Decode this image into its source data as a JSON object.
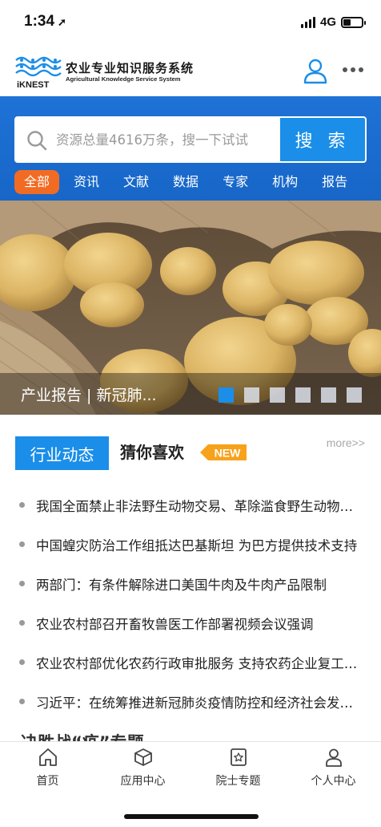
{
  "status_bar": {
    "time": "1:34",
    "network": "4G"
  },
  "app": {
    "logo_text": "iKNEST",
    "title": "农业专业知识服务系统",
    "subtitle": "Agricultural Knowledge Service System"
  },
  "search": {
    "placeholder": "资源总量4616万条，搜一下试试",
    "button_label": "搜 索"
  },
  "categories": [
    {
      "label": "全部",
      "active": true
    },
    {
      "label": "资讯",
      "active": false
    },
    {
      "label": "文献",
      "active": false
    },
    {
      "label": "数据",
      "active": false
    },
    {
      "label": "专家",
      "active": false
    },
    {
      "label": "机构",
      "active": false
    },
    {
      "label": "报告",
      "active": false
    }
  ],
  "banner": {
    "caption": "产业报告 | 新冠肺...",
    "slide_count": 6,
    "active_slide": 1
  },
  "news_tabs": {
    "industry_label": "行业动态",
    "guess_label": "猜你喜欢",
    "new_badge": "NEW",
    "more_label": "more>>"
  },
  "news_items": [
    "我国全面禁止非法野生动物交易、革除滥食野生动物陋习",
    "中国蝗灾防治工作组抵达巴基斯坦 为巴方提供技术支持",
    "两部门：有条件解除进口美国牛肉及牛肉产品限制",
    "农业农村部召开畜牧兽医工作部署视频会议强调",
    "农业农村部优化农药行政审批服务 支持农药企业复工复产",
    "习近平：在统筹推进新冠肺炎疫情防控和经济社会发展工作"
  ],
  "next_section_peek": "决胜战“疫”专题",
  "bottom_nav": [
    {
      "label": "首页",
      "icon": "home-icon"
    },
    {
      "label": "应用中心",
      "icon": "cube-icon"
    },
    {
      "label": "院士专题",
      "icon": "star-doc-icon"
    },
    {
      "label": "个人中心",
      "icon": "person-icon"
    }
  ],
  "colors": {
    "brand_blue": "#1d6dd1",
    "accent_blue": "#1a8ee8",
    "accent_orange": "#f26b23"
  }
}
